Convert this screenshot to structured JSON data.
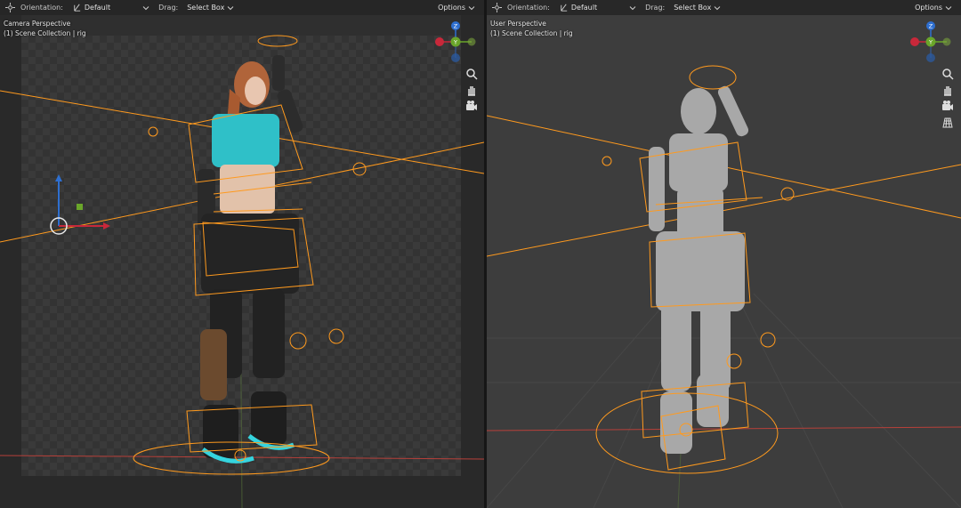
{
  "left": {
    "header": {
      "orientation_label": "Orientation:",
      "orientation_value": "Default",
      "drag_label": "Drag:",
      "drag_value": "Select Box",
      "options_label": "Options"
    },
    "overlay": {
      "view_name": "Camera Perspective",
      "collection": "(1) Scene Collection | rig"
    },
    "gizmo_axes": {
      "y": "Y",
      "z": "Z"
    }
  },
  "right": {
    "header": {
      "orientation_label": "Orientation:",
      "orientation_value": "Default",
      "drag_label": "Drag:",
      "drag_value": "Select Box",
      "options_label": "Options"
    },
    "overlay": {
      "view_name": "User Perspective",
      "collection": "(1) Scene Collection | rig"
    },
    "gizmo_axes": {
      "y": "Y",
      "z": "Z"
    }
  },
  "colors": {
    "x_axis": "#c8283a",
    "y_axis": "#6aa62a",
    "z_axis": "#2e6fd0",
    "bone": "#ff9a1e",
    "grid_red": "#b8403a"
  },
  "icons": [
    "transform-pivot-icon",
    "orientation-icon",
    "chevron-down-icon",
    "zoom-icon",
    "hand-pan-icon",
    "camera-view-icon",
    "grid-toggle-icon"
  ]
}
